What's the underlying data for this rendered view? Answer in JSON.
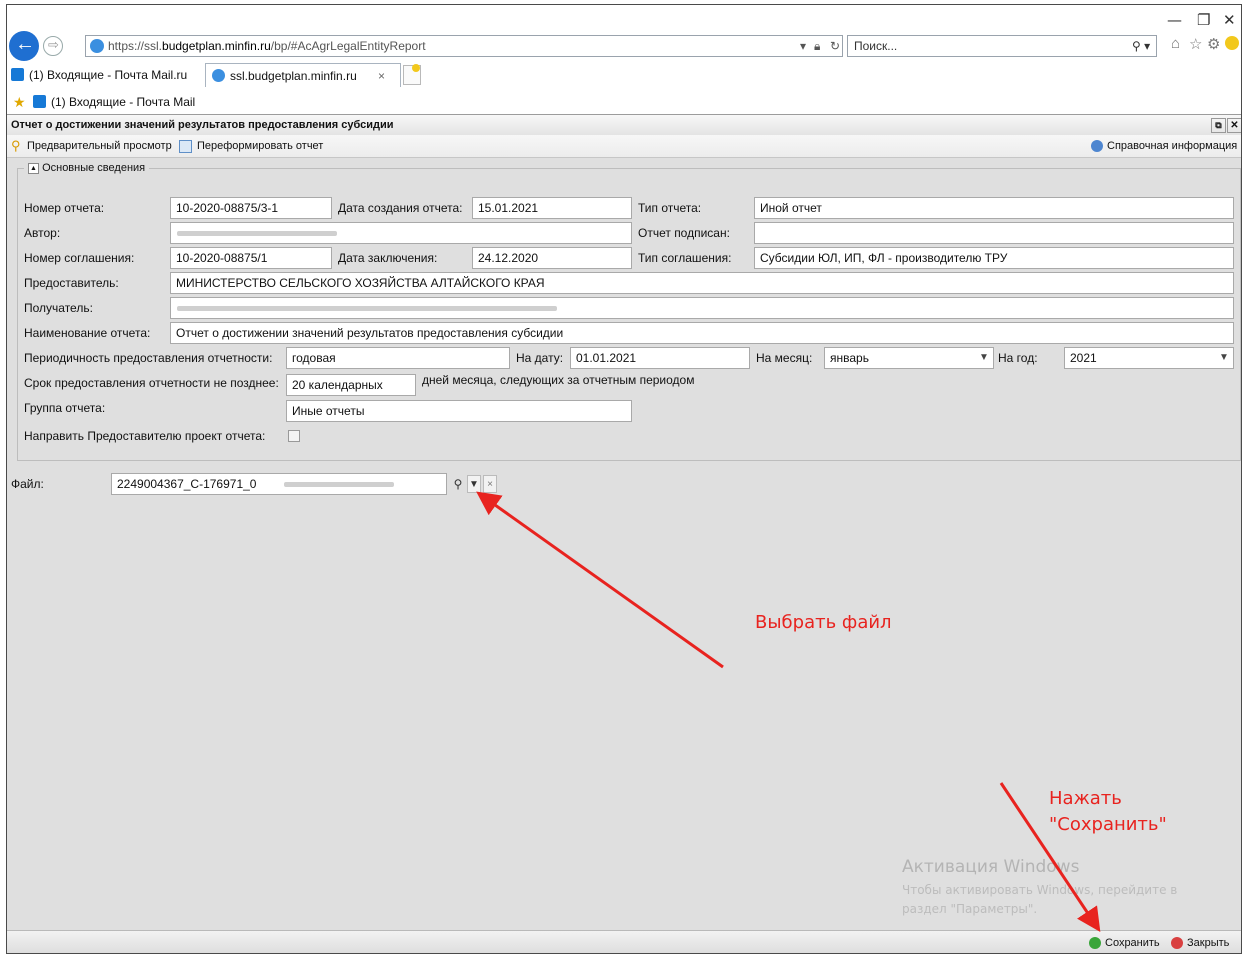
{
  "browser": {
    "url_prefix": "https://ssl.",
    "url_host": "budgetplan.minfin.ru",
    "url_path": "/bp/#AcAgrLegalEntityReport",
    "search_placeholder": "Поиск...",
    "tabs": [
      {
        "label": "(1) Входящие - Почта Mail.ru",
        "active": false
      },
      {
        "label": "ssl.budgetplan.minfin.ru",
        "active": true
      }
    ],
    "tab_close": "×",
    "favorites": [
      {
        "label": "(1) Входящие - Почта Mail"
      }
    ]
  },
  "app": {
    "title": "Отчет о достижении значений результатов предоставления субсидии",
    "toolbar": {
      "preview": "Предварительный просмотр",
      "reform": "Переформировать отчет",
      "help": "Справочная информация"
    },
    "section_title": "Основные сведения",
    "labels": {
      "report_number": "Номер отчета:",
      "created_date": "Дата создания отчета:",
      "report_type": "Тип отчета:",
      "author": "Автор:",
      "signed": "Отчет подписан:",
      "agreement_number": "Номер соглашения:",
      "conclusion_date": "Дата заключения:",
      "agreement_type": "Тип соглашения:",
      "provider": "Предоставитель:",
      "recipient": "Получатель:",
      "report_name": "Наименование отчета:",
      "periodicity": "Периодичность предоставления отчетности:",
      "on_date": "На дату:",
      "on_month": "На месяц:",
      "on_year": "На год:",
      "deadline": "Срок предоставления отчетности не позднее:",
      "deadline_suffix": "дней месяца, следующих за отчетным периодом",
      "group": "Группа отчета:",
      "send_draft": "Направить Предоставителю проект отчета:",
      "file": "Файл:"
    },
    "values": {
      "report_number": "10-2020-08875/3-1",
      "created_date": "15.01.2021",
      "report_type": "Иной отчет",
      "signed": "",
      "agreement_number": "10-2020-08875/1",
      "conclusion_date": "24.12.2020",
      "agreement_type": "Субсидии ЮЛ, ИП, ФЛ - производителю ТРУ",
      "provider": "МИНИСТЕРСТВО СЕЛЬСКОГО ХОЗЯЙСТВА АЛТАЙСКОГО КРАЯ",
      "report_name": "Отчет о достижении значений результатов предоставления субсидии",
      "periodicity": "годовая",
      "on_date": "01.01.2021",
      "on_month": "январь",
      "on_year": "2021",
      "deadline": "20 календарных",
      "group": "Иные отчеты",
      "send_draft_checked": false,
      "file": "2249004367_C-176971_0"
    },
    "status": {
      "save": "Сохранить",
      "close": "Закрыть"
    }
  },
  "annotations": {
    "choose_file": "Выбрать файл",
    "press_save_line1": "Нажать",
    "press_save_line2": "\"Сохранить\""
  },
  "watermark": {
    "line1": "Активация Windows",
    "line2": "Чтобы активировать Windows, перейдите в",
    "line3": "раздел \"Параметры\"."
  },
  "colors": {
    "annotation": "#e8231f",
    "back_button": "#1f6fd1",
    "save_icon": "#3aa53a",
    "close_icon": "#d94040"
  }
}
